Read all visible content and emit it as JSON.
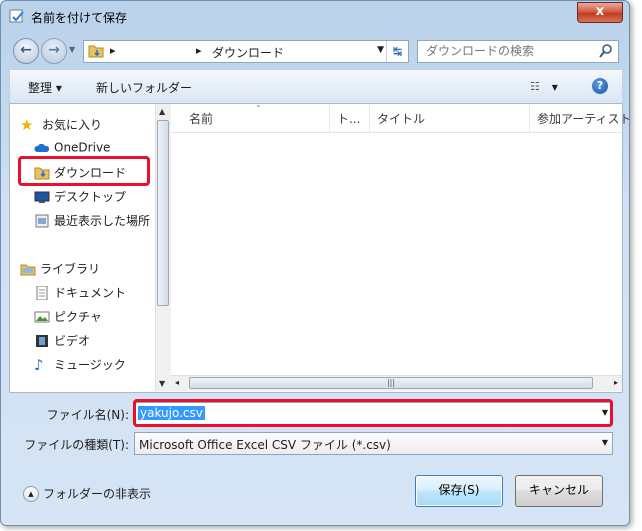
{
  "window": {
    "title": "名前を付けて保存",
    "close_label": "x"
  },
  "nav": {
    "back_label": "←",
    "forward_label": "→",
    "address": {
      "crumb": "ダウンロード",
      "separator": "▸"
    },
    "search_placeholder": "ダウンロードの検索"
  },
  "toolbar": {
    "organize_label": "整理 ▾",
    "new_folder_label": "新しいフォルダー",
    "help_label": "?"
  },
  "sidebar": {
    "favorites_label": "お気に入り",
    "favorites": [
      "OneDrive",
      "ダウンロード",
      "デスクトップ",
      "最近表示した場所"
    ],
    "libraries_label": "ライブラリ",
    "libraries": [
      "ドキュメント",
      "ピクチャ",
      "ビデオ",
      "ミュージック"
    ]
  },
  "columns": [
    "名前",
    "ト...",
    "タイトル",
    "参加アーティスト"
  ],
  "form": {
    "filename_label": "ファイル名(N):",
    "filename_value": "yakujo.csv",
    "filetype_label": "ファイルの種類(T):",
    "filetype_value": "Microsoft Office Excel CSV ファイル (*.csv)"
  },
  "footer": {
    "hide_folders_label": "フォルダーの非表示",
    "save_label": "保存(S)",
    "cancel_label": "キャンセル"
  },
  "colors": {
    "highlight": "#e8102c",
    "selection": "#3399ff"
  }
}
